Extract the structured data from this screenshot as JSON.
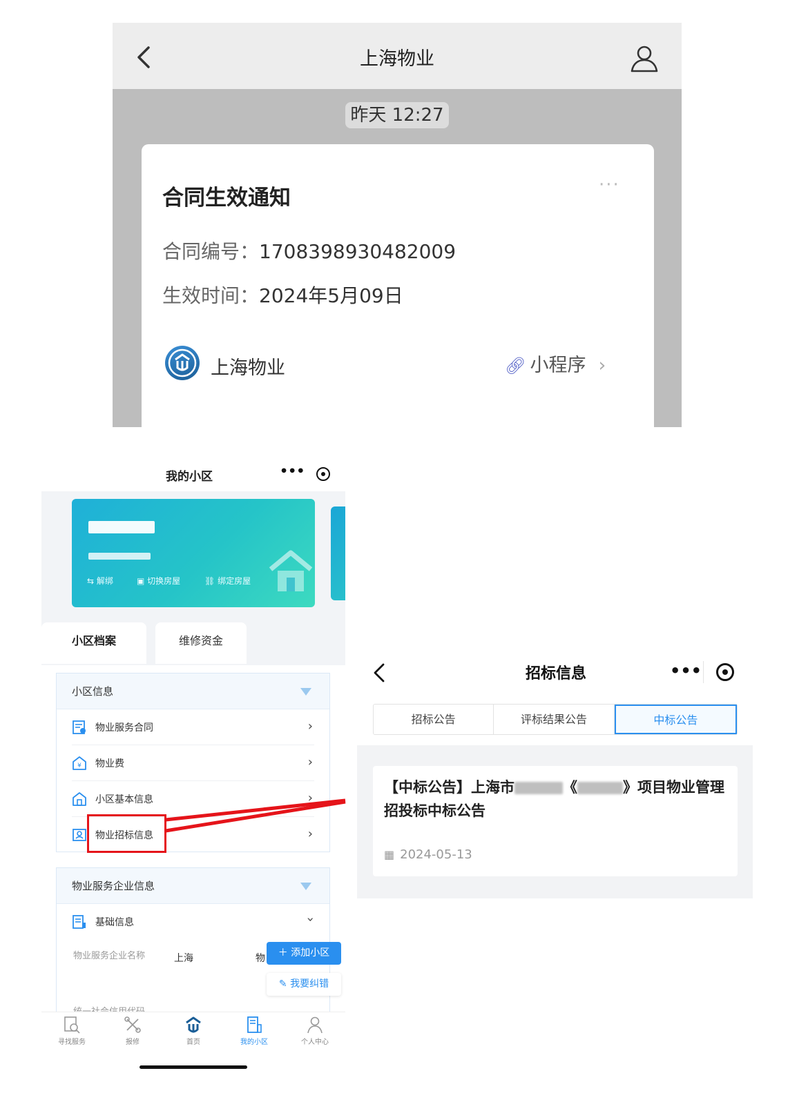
{
  "chat": {
    "title": "上海物业",
    "time_label": "昨天 12:27",
    "card": {
      "title": "合同生效通知",
      "more": "···",
      "contract_no_label": "合同编号：",
      "contract_no_value": "1708398930482009",
      "effective_label": "生效时间：",
      "effective_value": "2024年5月09日",
      "brand": "上海物业",
      "mini_program": "小程序"
    }
  },
  "mine": {
    "header_title": "我的小区",
    "header_more": "•••",
    "house_actions": [
      "解绑",
      "切换房屋",
      "绑定房屋"
    ],
    "tabs": [
      "小区档案",
      "维修资金"
    ],
    "section_info": {
      "title": "小区信息",
      "items": [
        "物业服务合同",
        "物业费",
        "小区基本信息",
        "物业招标信息"
      ]
    },
    "section_company": {
      "title": "物业服务企业信息",
      "basic_label": "基础信息",
      "field_label": "物业服务企业名称",
      "field_value": "上海",
      "field_tail": "物",
      "cut_text": "统一社会信用代码"
    },
    "fab_add": "添加小区",
    "fab_correct": "我要纠错",
    "nav": [
      "寻找服务",
      "报修",
      "首页",
      "我的小区",
      "个人中心"
    ]
  },
  "bid": {
    "title": "招标信息",
    "more": "•••",
    "tabs": [
      "招标公告",
      "评标结果公告",
      "中标公告"
    ],
    "active_tab": "中标公告",
    "card": {
      "title_prefix": "【中标公告】上海市",
      "title_mid": "《",
      "title_suffix": "》项目物业管理招投标中标公告",
      "date": "2024-05-13"
    }
  },
  "colors": {
    "accent": "#2a8fef",
    "annotation": "#e5141a",
    "card_gradient_start": "#1fb0d8"
  }
}
